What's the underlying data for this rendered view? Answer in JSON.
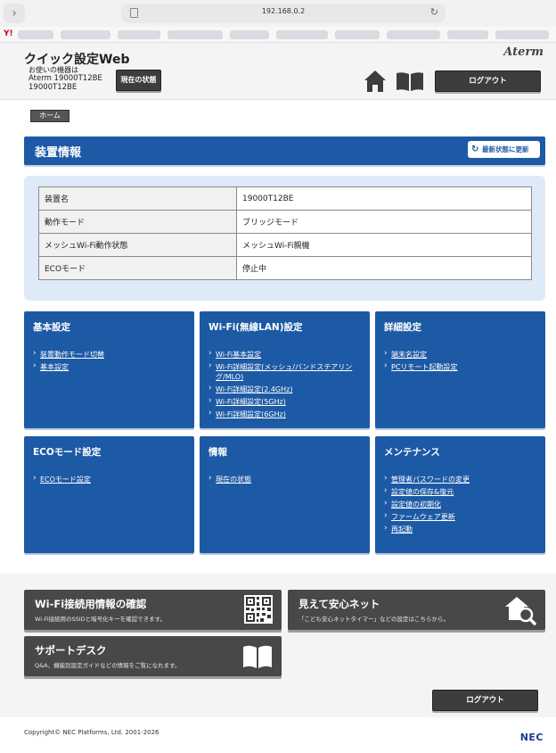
{
  "browser": {
    "url": "192.168.0.2"
  },
  "header": {
    "title": "クイック設定Web",
    "device_caption": "お使いの機器は",
    "device_line1": "Aterm 19000T12BE",
    "device_line2": "19000T12BE",
    "status_button": "現在の状態",
    "brand": "Aterm",
    "logout": "ログアウト"
  },
  "breadcrumb": {
    "home": "ホーム"
  },
  "section": {
    "title": "装置情報",
    "refresh": "最新状態に更新"
  },
  "device_info": {
    "rows": [
      {
        "label": "装置名",
        "value": "19000T12BE"
      },
      {
        "label": "動作モード",
        "value": "ブリッジモード"
      },
      {
        "label": "メッシュWi-Fi動作状態",
        "value": "メッシュWi-Fi親機"
      },
      {
        "label": "ECOモード",
        "value": "停止中"
      }
    ]
  },
  "tiles": [
    {
      "title": "基本設定",
      "links": [
        "装置動作モード切替",
        "基本設定"
      ]
    },
    {
      "title": "Wi-Fi(無線LAN)設定",
      "links": [
        "Wi-Fi基本設定",
        "Wi-Fi詳細設定(メッシュ/バンドステアリング/MLO)",
        "Wi-Fi詳細設定(2.4GHz)",
        "Wi-Fi詳細設定(5GHz)",
        "Wi-Fi詳細設定(6GHz)"
      ]
    },
    {
      "title": "詳細設定",
      "links": [
        "端末名設定",
        "PCリモート起動設定"
      ]
    },
    {
      "title": "ECOモード設定",
      "links": [
        "ECOモード設定"
      ]
    },
    {
      "title": "情報",
      "links": [
        "現在の状態"
      ]
    },
    {
      "title": "メンテナンス",
      "links": [
        "管理者パスワードの変更",
        "設定値の保存&復元",
        "設定値の初期化",
        "ファームウェア更新",
        "再起動"
      ]
    }
  ],
  "promos": {
    "wifi_info": {
      "title": "Wi-Fi接続用情報の確認",
      "desc": "Wi-Fi接続用のSSIDと暗号化キーを確認できます。"
    },
    "safety_net": {
      "title": "見えて安心ネット",
      "desc": "「こども安心ネットタイマー」などの設定はこちらから。"
    },
    "support": {
      "title": "サポートデスク",
      "desc": "Q&A、機能別設定ガイドなどの情報をご覧になれます。"
    }
  },
  "footer": {
    "logout": "ログアウト",
    "copyright": "Copyright© NEC Platforms, Ltd. 2001-2026",
    "logo": "NEC"
  },
  "colors": {
    "primary_blue": "#1d5aa5",
    "dark_button": "#3c3c3c",
    "panel_bg": "#deeaf7"
  }
}
